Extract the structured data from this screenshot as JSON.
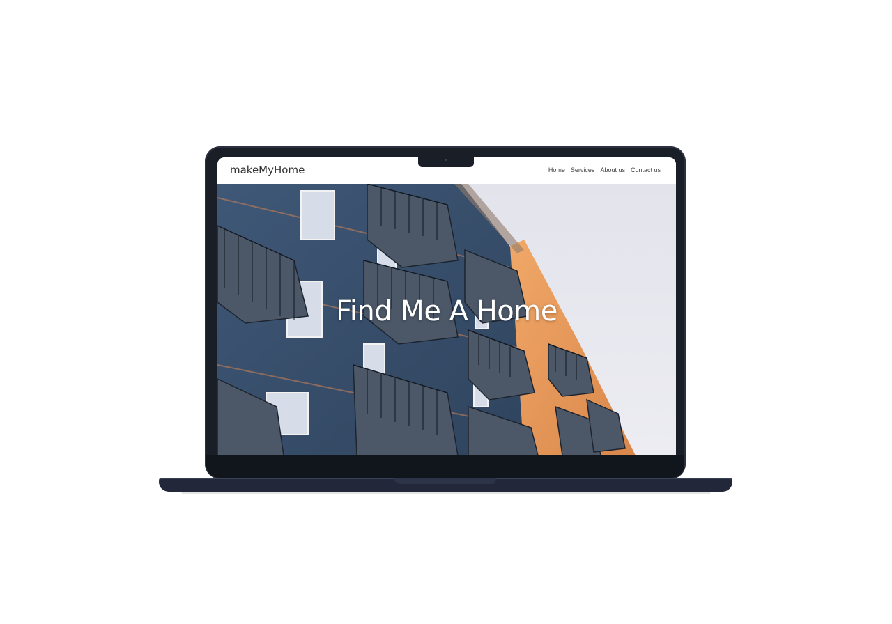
{
  "site": {
    "brand": "makeMyHome",
    "nav": [
      "Home",
      "Services",
      "About us",
      "Contact us"
    ],
    "hero_title": "Find Me A Home"
  },
  "icons": {
    "camera": "camera-icon"
  },
  "colors": {
    "building_blue": "#3c5472",
    "building_orange": "#e89a58",
    "sky": "#e7e8f0",
    "laptop_frame": "#1a1e27"
  }
}
